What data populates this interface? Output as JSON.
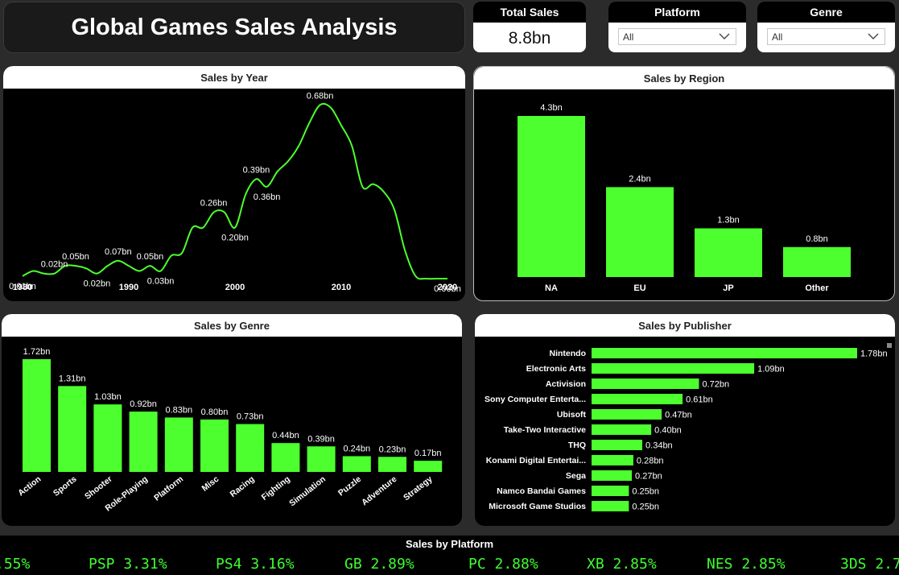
{
  "header": {
    "title": "Global Games Sales Analysis"
  },
  "kpi": {
    "label": "Total Sales",
    "value": "8.8bn"
  },
  "slicers": [
    {
      "label": "Platform",
      "value": "All"
    },
    {
      "label": "Genre",
      "value": "All"
    }
  ],
  "accent_color": "#4dff2e",
  "chart_data": [
    {
      "type": "line",
      "title": "Sales by Year",
      "x": [
        1980,
        1981,
        1982,
        1983,
        1984,
        1985,
        1986,
        1987,
        1988,
        1989,
        1990,
        1991,
        1992,
        1993,
        1994,
        1995,
        1996,
        1997,
        1998,
        1999,
        2000,
        2001,
        2002,
        2003,
        2004,
        2005,
        2006,
        2007,
        2008,
        2009,
        2010,
        2011,
        2012,
        2013,
        2014,
        2015,
        2016,
        2017,
        2018,
        2019,
        2020
      ],
      "y": [
        0.01,
        0.03,
        0.02,
        0.02,
        0.05,
        0.05,
        0.04,
        0.02,
        0.05,
        0.07,
        0.05,
        0.03,
        0.05,
        0.03,
        0.09,
        0.1,
        0.2,
        0.2,
        0.26,
        0.26,
        0.2,
        0.33,
        0.39,
        0.36,
        0.42,
        0.46,
        0.52,
        0.61,
        0.68,
        0.67,
        0.6,
        0.52,
        0.36,
        0.37,
        0.34,
        0.27,
        0.11,
        0.01,
        0.0,
        0.0,
        0.0
      ],
      "labels": [
        {
          "x": 1980,
          "text": "0.01bn"
        },
        {
          "x": 1983,
          "text": "0.02bn"
        },
        {
          "x": 1985,
          "text": "0.05bn"
        },
        {
          "x": 1987,
          "text": "0.02bn"
        },
        {
          "x": 1989,
          "text": "0.07bn"
        },
        {
          "x": 1992,
          "text": "0.05bn"
        },
        {
          "x": 1993,
          "text": "0.03bn"
        },
        {
          "x": 1998,
          "text": "0.26bn"
        },
        {
          "x": 2000,
          "text": "0.20bn"
        },
        {
          "x": 2002,
          "text": "0.39bn"
        },
        {
          "x": 2003,
          "text": "0.36bn"
        },
        {
          "x": 2008,
          "text": "0.68bn"
        },
        {
          "x": 2020,
          "text": "0.00bn"
        }
      ],
      "x_ticks": [
        "1980",
        "1990",
        "2000",
        "2010",
        "2020"
      ],
      "xlim": [
        1980,
        2020
      ]
    },
    {
      "type": "bar",
      "title": "Sales by Region",
      "categories": [
        "NA",
        "EU",
        "JP",
        "Other"
      ],
      "values": [
        4.3,
        2.4,
        1.3,
        0.8
      ],
      "data_labels": [
        "4.3bn",
        "2.4bn",
        "1.3bn",
        "0.8bn"
      ]
    },
    {
      "type": "bar",
      "title": "Sales by Genre",
      "categories": [
        "Action",
        "Sports",
        "Shooter",
        "Role-Playing",
        "Platform",
        "Misc",
        "Racing",
        "Fighting",
        "Simulation",
        "Puzzle",
        "Adventure",
        "Strategy"
      ],
      "values": [
        1.72,
        1.31,
        1.03,
        0.92,
        0.83,
        0.8,
        0.73,
        0.44,
        0.39,
        0.24,
        0.23,
        0.17
      ],
      "data_labels": [
        "1.72bn",
        "1.31bn",
        "1.03bn",
        "0.92bn",
        "0.83bn",
        "0.80bn",
        "0.73bn",
        "0.44bn",
        "0.39bn",
        "0.24bn",
        "0.23bn",
        "0.17bn"
      ]
    },
    {
      "type": "bar",
      "orientation": "horizontal",
      "title": "Sales by Publisher",
      "categories": [
        "Nintendo",
        "Electronic Arts",
        "Activision",
        "Sony Computer Enterta...",
        "Ubisoft",
        "Take-Two Interactive",
        "THQ",
        "Konami Digital Entertai...",
        "Sega",
        "Namco Bandai Games",
        "Microsoft Game Studios"
      ],
      "values": [
        1.78,
        1.09,
        0.72,
        0.61,
        0.47,
        0.4,
        0.34,
        0.28,
        0.27,
        0.25,
        0.25
      ],
      "data_labels": [
        "1.78bn",
        "1.09bn",
        "0.72bn",
        "0.61bn",
        "0.47bn",
        "0.40bn",
        "0.34bn",
        "0.28bn",
        "0.27bn",
        "0.25bn",
        "0.25bn"
      ]
    }
  ],
  "ticker": {
    "title": "Sales by Platform",
    "items": [
      ".55%",
      "PSP 3.31%",
      "PS4 3.16%",
      "GB 2.89%",
      "PC 2.88%",
      "XB 2.85%",
      "NES 2.85%",
      "3DS 2.7"
    ]
  }
}
